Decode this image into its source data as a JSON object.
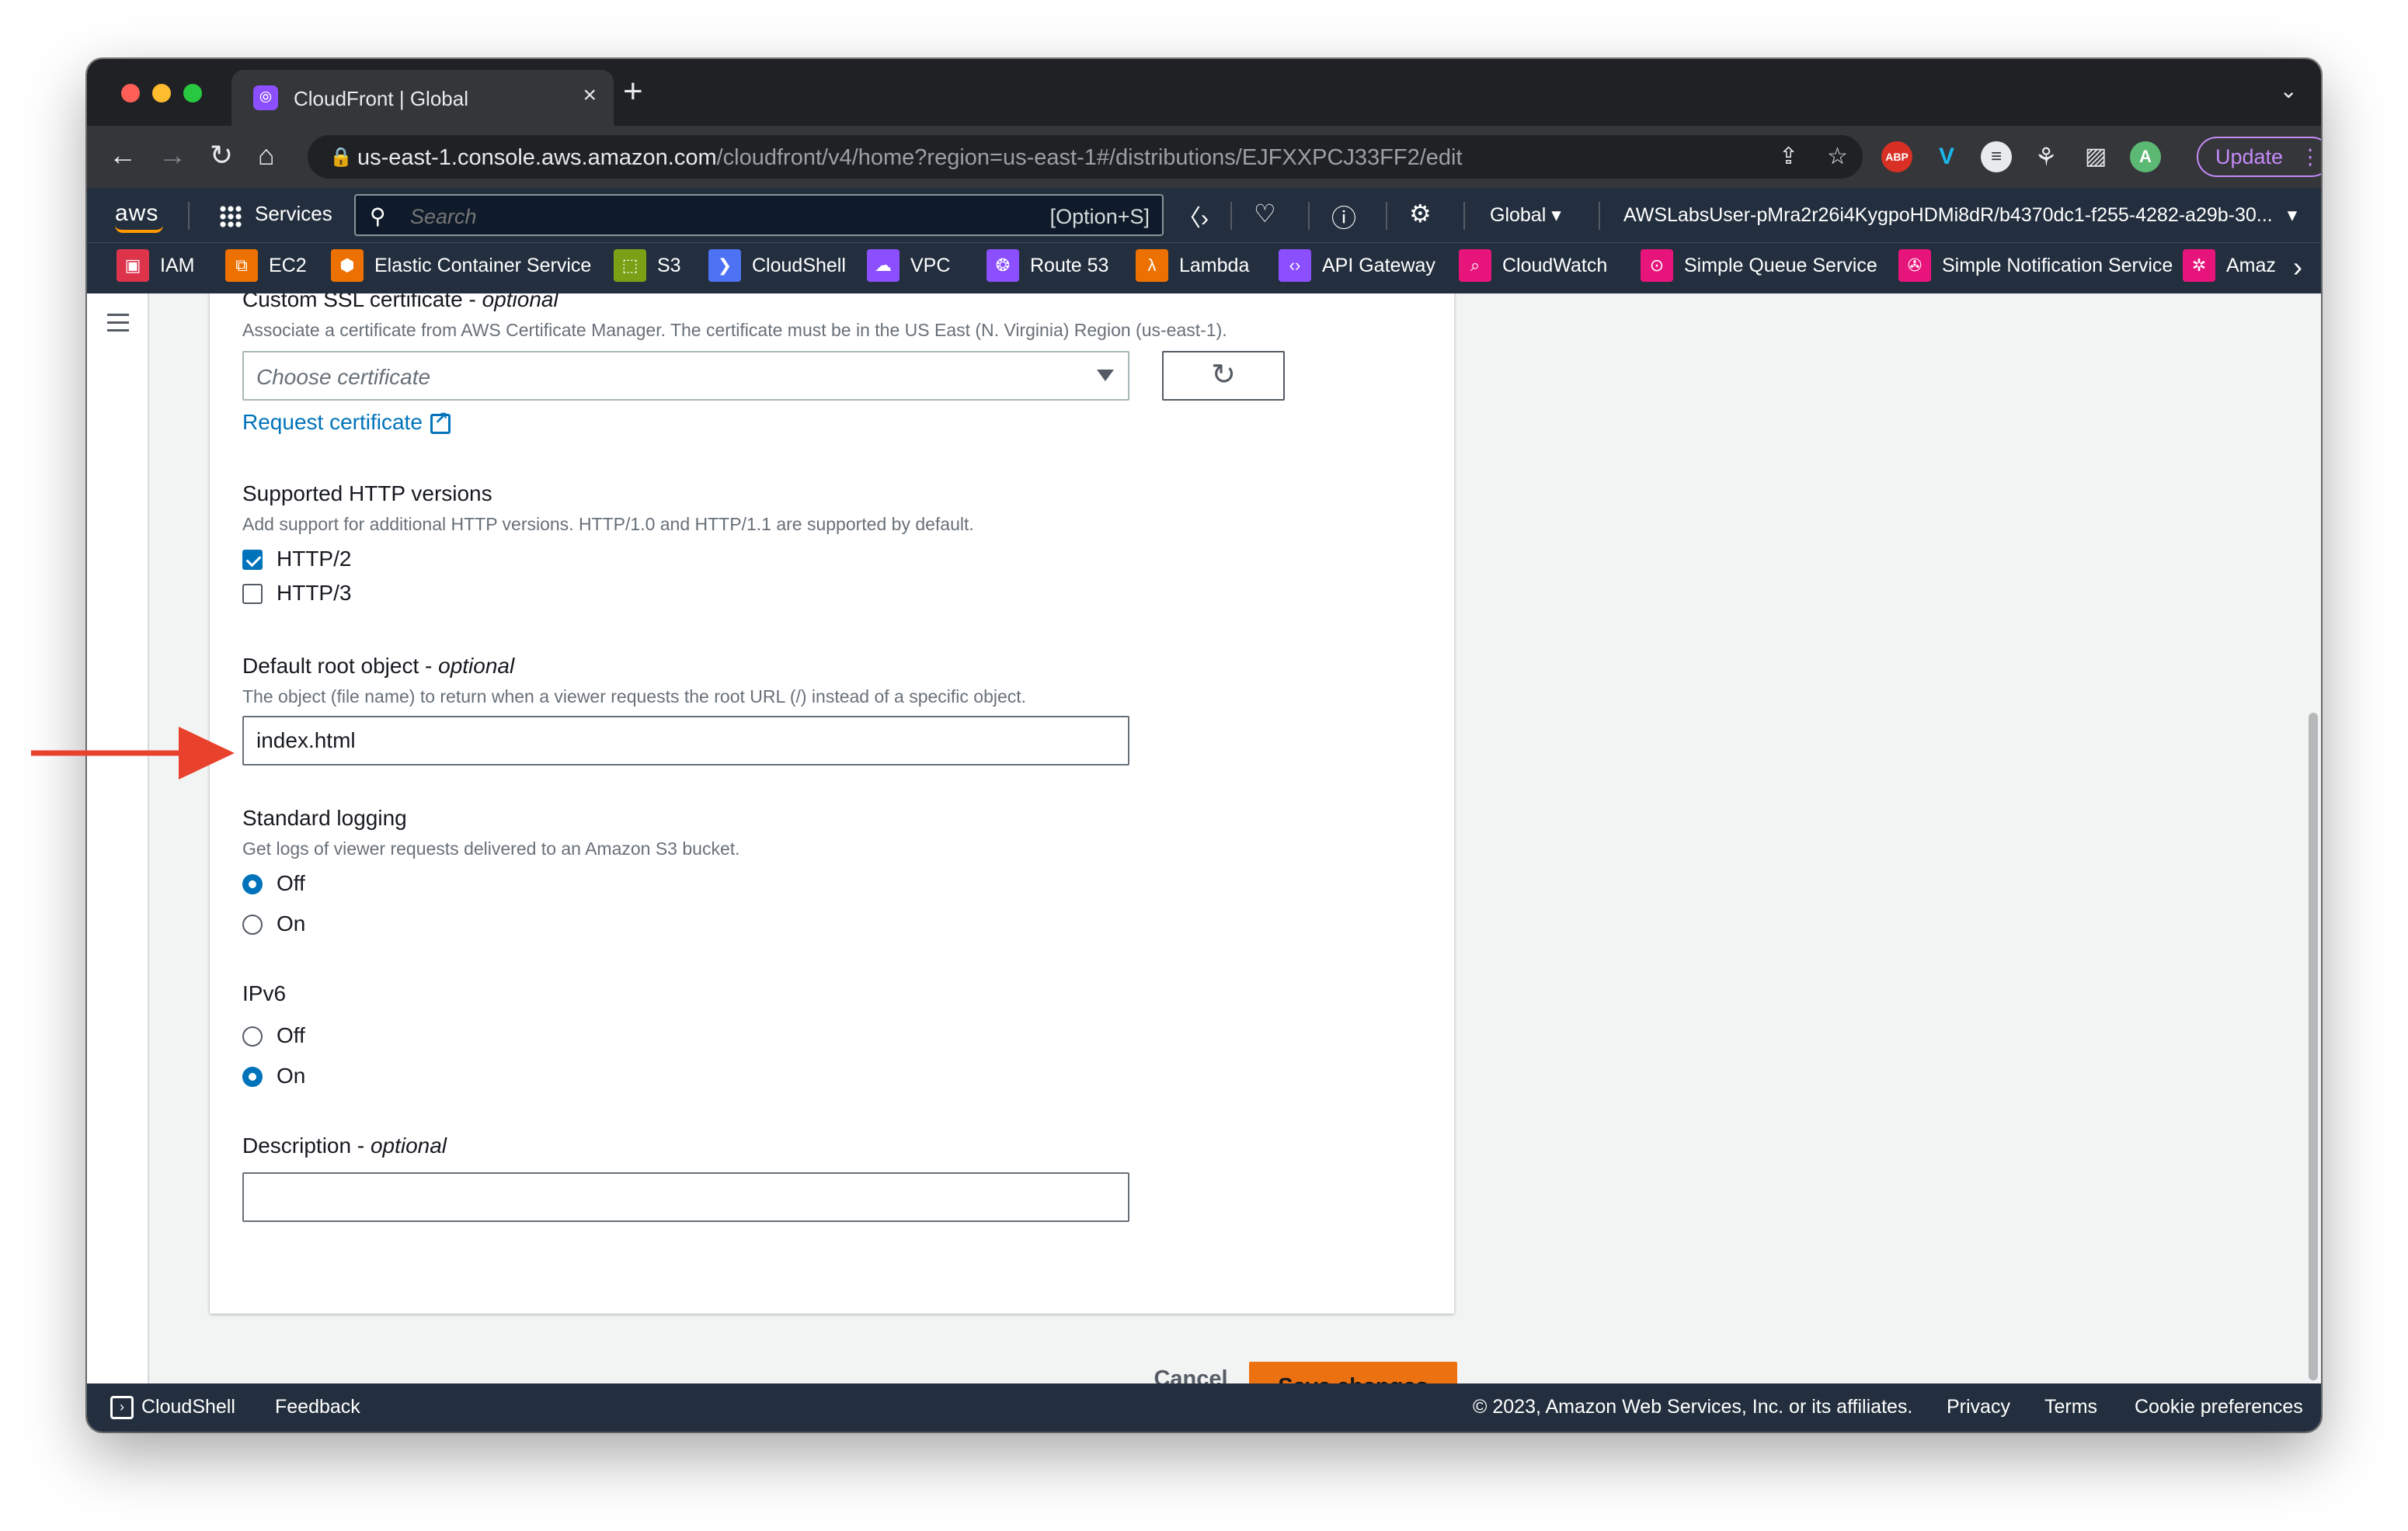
{
  "browser": {
    "tab_title": "CloudFront | Global",
    "tab_icon": "cloudfront-icon",
    "url_host": "us-east-1.console.aws.amazon.com",
    "url_path": "/cloudfront/v4/home?region=us-east-1#/distributions/EJFXXPCJ33FF2/edit",
    "update_label": "Update",
    "extensions": [
      "ABP",
      "V",
      "≡",
      "⚘",
      "▨",
      "A"
    ]
  },
  "aws_nav": {
    "logo": "aws",
    "services_label": "Services",
    "search_placeholder": "Search",
    "search_shortcut": "[Option+S]",
    "region": "Global",
    "account": "AWSLabsUser-pMra2r26i4KygpoHDMi8dR/b4370dc1-f255-4282-a29b-30..."
  },
  "favorites": [
    {
      "label": "IAM",
      "color": "#dd344c",
      "icon": "iam-icon",
      "glyph": "▣"
    },
    {
      "label": "EC2",
      "color": "#ed7100",
      "icon": "ec2-icon",
      "glyph": "⧉"
    },
    {
      "label": "Elastic Container Service",
      "color": "#ed7100",
      "icon": "ecs-icon",
      "glyph": "⬢"
    },
    {
      "label": "S3",
      "color": "#7aa116",
      "icon": "s3-icon",
      "glyph": "⬚"
    },
    {
      "label": "CloudShell",
      "color": "#4d72f3",
      "icon": "cloudshell-icon",
      "glyph": "❯"
    },
    {
      "label": "VPC",
      "color": "#8c4fff",
      "icon": "vpc-icon",
      "glyph": "☁"
    },
    {
      "label": "Route 53",
      "color": "#8c4fff",
      "icon": "route53-icon",
      "glyph": "❂"
    },
    {
      "label": "Lambda",
      "color": "#ed7100",
      "icon": "lambda-icon",
      "glyph": "λ"
    },
    {
      "label": "API Gateway",
      "color": "#8c4fff",
      "icon": "api-gateway-icon",
      "glyph": "‹›"
    },
    {
      "label": "CloudWatch",
      "color": "#e7157b",
      "icon": "cloudwatch-icon",
      "glyph": "⌕"
    },
    {
      "label": "Simple Queue Service",
      "color": "#e7157b",
      "icon": "sqs-icon",
      "glyph": "⊙"
    },
    {
      "label": "Simple Notification Service",
      "color": "#e7157b",
      "icon": "sns-icon",
      "glyph": "✇"
    },
    {
      "label": "Amaz",
      "color": "#e7157b",
      "icon": "amazon-icon",
      "glyph": "✲"
    }
  ],
  "form": {
    "ssl_label": "Custom SSL certificate - ",
    "ssl_optional": "optional",
    "ssl_desc": "Associate a certificate from AWS Certificate Manager. The certificate must be in the US East (N. Virginia) Region (us-east-1).",
    "ssl_placeholder": "Choose certificate",
    "request_cert_link": "Request certificate",
    "http_label": "Supported HTTP versions",
    "http_desc": "Add support for additional HTTP versions. HTTP/1.0 and HTTP/1.1 are supported by default.",
    "http2_label": "HTTP/2",
    "http2_checked": true,
    "http3_label": "HTTP/3",
    "http3_checked": false,
    "root_label": "Default root object - ",
    "root_optional": "optional",
    "root_desc": "The object (file name) to return when a viewer requests the root URL (/) instead of a specific object.",
    "root_value": "index.html",
    "logging_label": "Standard logging",
    "logging_desc": "Get logs of viewer requests delivered to an Amazon S3 bucket.",
    "logging_off": "Off",
    "logging_on": "On",
    "logging_selected": "Off",
    "ipv6_label": "IPv6",
    "ipv6_off": "Off",
    "ipv6_on": "On",
    "ipv6_selected": "On",
    "description_label": "Description - ",
    "description_optional": "optional",
    "description_value": ""
  },
  "actions": {
    "cancel": "Cancel",
    "save": "Save changes"
  },
  "footer": {
    "cloudshell": "CloudShell",
    "feedback": "Feedback",
    "copyright": "© 2023, Amazon Web Services, Inc. or its affiliates.",
    "privacy": "Privacy",
    "terms": "Terms",
    "cookies": "Cookie preferences"
  },
  "colors": {
    "accent_orange": "#ec7211",
    "link_blue": "#0073bb",
    "annotation_red": "#e8412c"
  }
}
